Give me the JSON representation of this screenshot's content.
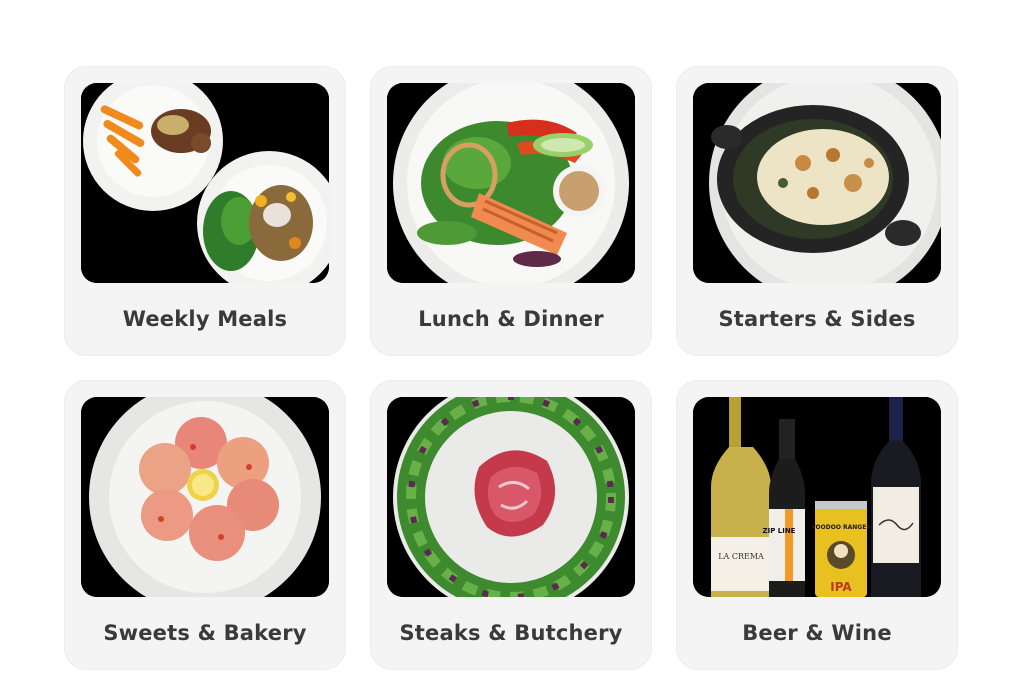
{
  "categories": [
    {
      "label": "Weekly Meals"
    },
    {
      "label": "Lunch & Dinner"
    },
    {
      "label": "Starters & Sides"
    },
    {
      "label": "Sweets & Bakery"
    },
    {
      "label": "Steaks & Butchery"
    },
    {
      "label": "Beer & Wine"
    }
  ],
  "wine_labels": {
    "bottle1": "LA CREMA",
    "bottle2": "ZIP LINE",
    "can": "VOODOO RANGER",
    "can_sub": "IPA"
  },
  "colors": {
    "card_bg": "#f4f4f4",
    "label_text": "#3a3a3a",
    "photo_bg": "#000000"
  }
}
